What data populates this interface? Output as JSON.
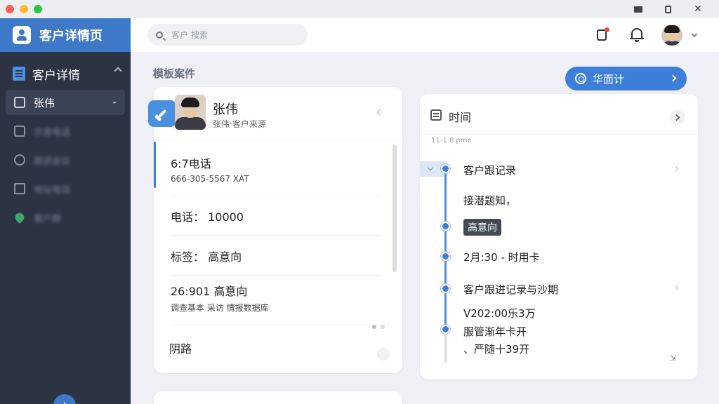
{
  "app": {
    "header_title": "客户详情页",
    "section_label": "客户详情",
    "page_section_title": "模板案件",
    "primary_button": "华面计"
  },
  "sidebar": {
    "items": [
      {
        "label": "张伟",
        "active": true
      },
      {
        "label": "示意电话",
        "active": false
      },
      {
        "label": "跟进会议",
        "active": false
      },
      {
        "label": "地址电话",
        "active": false
      },
      {
        "label": "客户群",
        "active": false
      }
    ],
    "fab_symbol": "✦"
  },
  "search": {
    "placeholder": "客户 搜索"
  },
  "contact": {
    "name": "张伟",
    "subtitle": "张伟·客户来源"
  },
  "detail_rows": [
    {
      "line1": "6:7电话",
      "line2": "666-305-5567 XAT"
    },
    {
      "line1": "电话： 10000",
      "line2": ""
    },
    {
      "line1": "标签： 高意向",
      "line2": ""
    },
    {
      "line1": "26:901 高意向",
      "line2": "调查基本 采访 情报数据库"
    },
    {
      "line1": "阴路",
      "line2": ""
    }
  ],
  "timeline": {
    "title": "时间",
    "date": "11-1 8 pme",
    "entries": [
      {
        "text": "客户跟记录"
      },
      {
        "text": "接潜题知，"
      },
      {
        "badge": "高意向"
      },
      {
        "text": "2月:30 - 时用卡"
      },
      {
        "text": "客户跟进记录与沙期"
      },
      {
        "text": "V202:00乐3万"
      },
      {
        "text": "服管渐年卡开"
      },
      {
        "text": "、严随十39开"
      }
    ],
    "footer_icon": "send-icon"
  },
  "colors": {
    "sidebar_bg": "#2c3444",
    "accent": "#3d7fd8",
    "header_blue": "#3d79c8",
    "badge_dark": "#444a54",
    "notification_red": "#e84a4a"
  }
}
